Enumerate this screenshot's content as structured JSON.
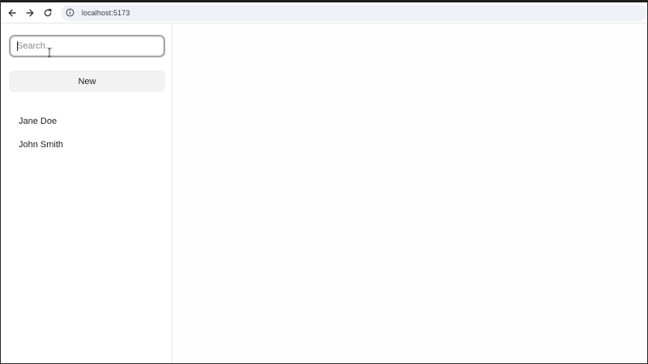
{
  "browser": {
    "url": "localhost:5173",
    "icons": {
      "back": "back-arrow-icon",
      "forward": "forward-arrow-icon",
      "reload": "reload-icon",
      "site_info": "info-icon"
    }
  },
  "sidebar": {
    "search": {
      "value": "",
      "placeholder": "Search..."
    },
    "new_label": "New",
    "contacts": [
      {
        "name": "Jane Doe"
      },
      {
        "name": "John Smith"
      }
    ]
  },
  "colors": {
    "address_bar": "#eef1f8",
    "button_bg": "#f2f2f2",
    "search_border": "#a8a8a8"
  }
}
